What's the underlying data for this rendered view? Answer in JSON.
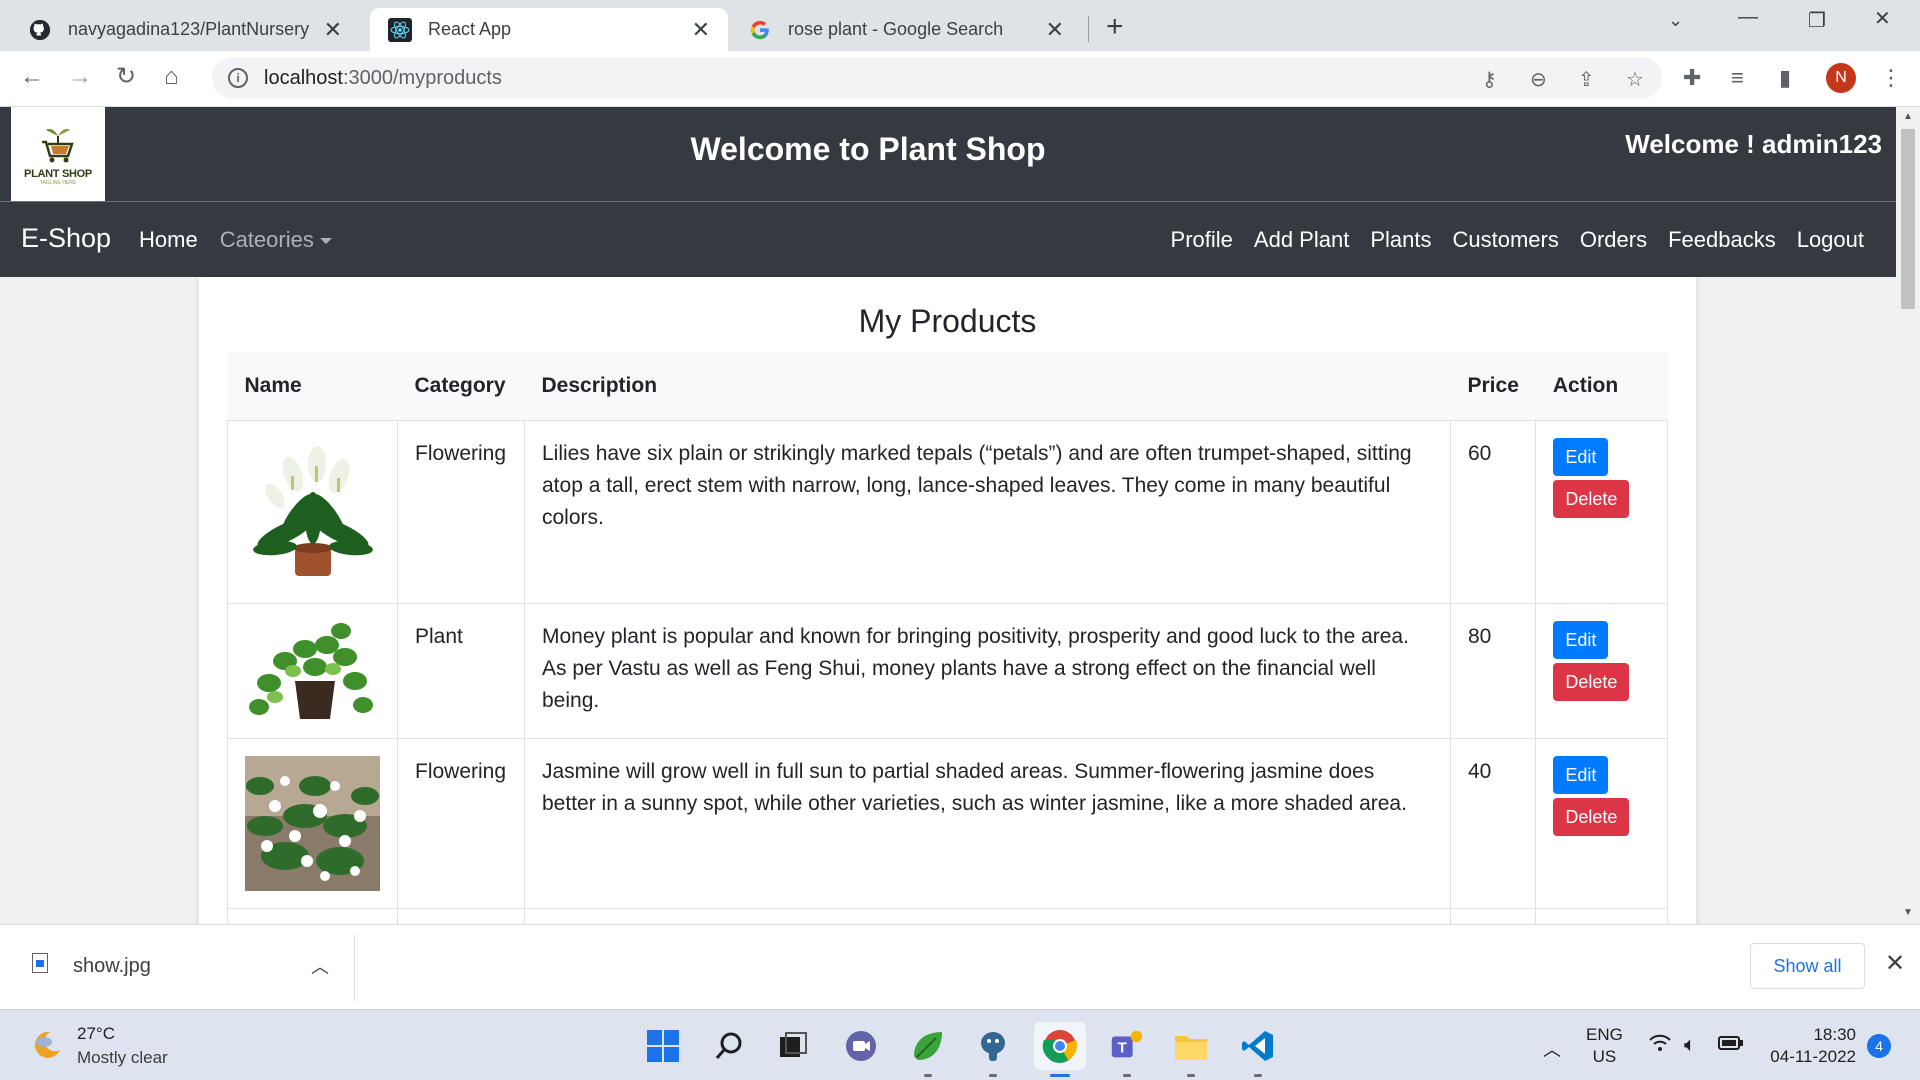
{
  "browser": {
    "tabs": [
      {
        "title": "navyagadina123/PlantNursery",
        "icon": "github-icon"
      },
      {
        "title": "React App",
        "icon": "react-icon"
      },
      {
        "title": "rose plant - Google Search",
        "icon": "google-icon"
      }
    ],
    "active_tab": 1,
    "url_host": "localhost",
    "url_path": ":3000/myproducts",
    "profile_initial": "N"
  },
  "site": {
    "logo_text": "PLANT SHOP",
    "logo_tagline": "TAGLINE HERE",
    "header_title": "Welcome to Plant Shop",
    "header_user": "Welcome ! admin123",
    "brand": "E-Shop",
    "nav_left": {
      "home": "Home",
      "categories": "Cateories"
    },
    "nav_right": [
      "Profile",
      "Add Plant",
      "Plants",
      "Customers",
      "Orders",
      "Feedbacks",
      "Logout"
    ]
  },
  "products": {
    "title": "My Products",
    "columns": [
      "Name",
      "Category",
      "Description",
      "Price",
      "Action"
    ],
    "rows": [
      {
        "category": "Flowering",
        "description": "Lilies have six plain or strikingly marked tepals (“petals”) and are often trumpet-shaped, sitting atop a tall, erect stem with narrow, long, lance-shaped leaves. They come in many beautiful colors.",
        "price": "60"
      },
      {
        "category": "Plant",
        "description": "Money plant is popular and known for bringing positivity, prosperity and good luck to the area. As per Vastu as well as Feng Shui, money plants have a strong effect on the financial well being.",
        "price": "80"
      },
      {
        "category": "Flowering",
        "description": "Jasmine will grow well in full sun to partial shaded areas. Summer-flowering jasmine does better in a sunny spot, while other varieties, such as winter jasmine, like a more shaded area.",
        "price": "40"
      }
    ],
    "edit_label": "Edit",
    "delete_label": "Delete"
  },
  "download_shelf": {
    "file_name": "show.jpg",
    "show_all": "Show all"
  },
  "taskbar": {
    "temperature": "27°C",
    "condition": "Mostly clear",
    "lang_1": "ENG",
    "lang_2": "US",
    "time": "18:30",
    "date": "04-11-2022",
    "notifications": "4"
  },
  "colors": {
    "header_bg": "#343a40",
    "edit_button": "#007bff",
    "delete_button": "#dc3545",
    "chrome_tabbar": "#dfe3e8"
  }
}
